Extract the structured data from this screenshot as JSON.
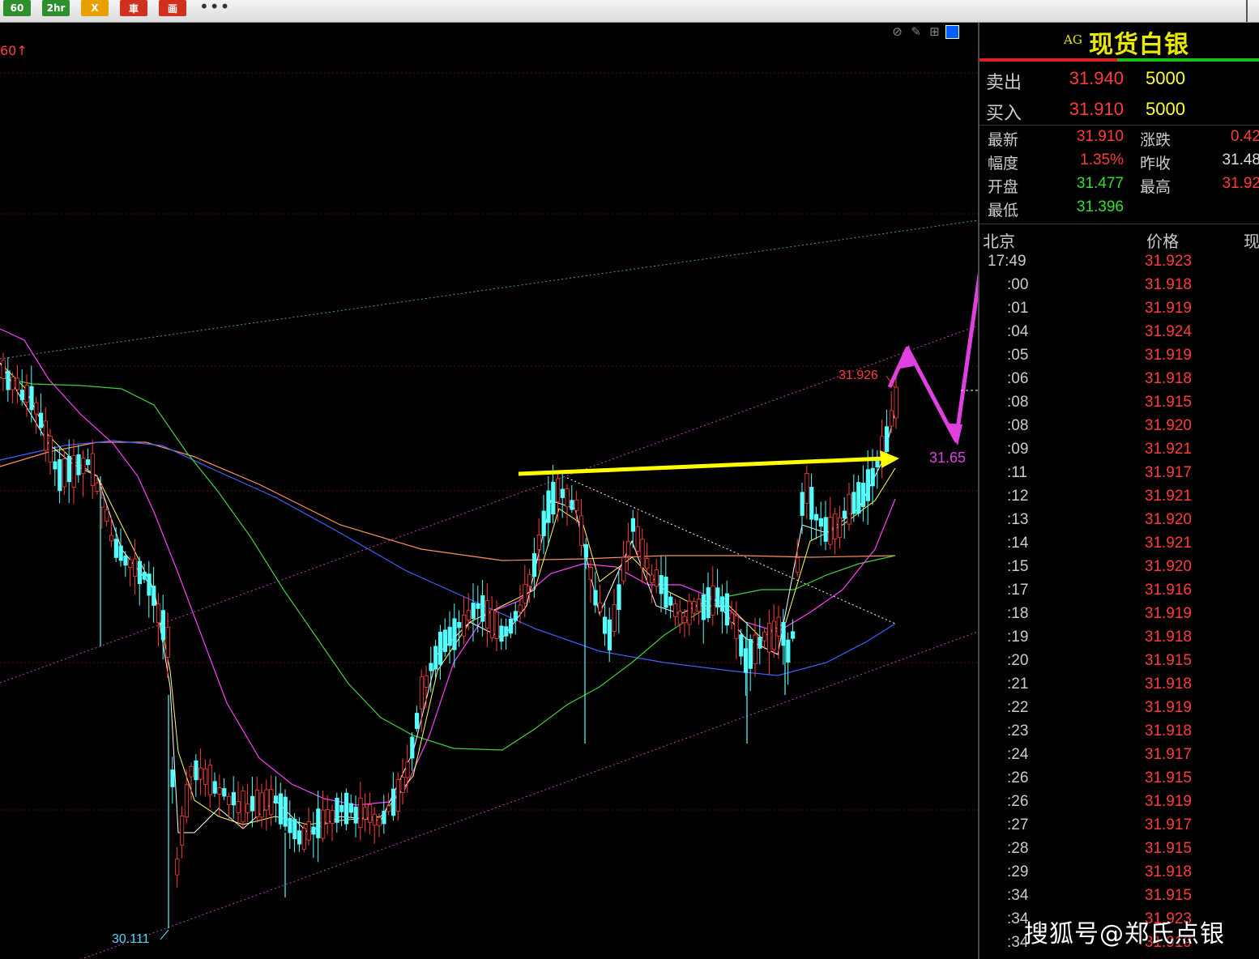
{
  "toolbar": {
    "buttons": [
      {
        "label": "60",
        "color": "#2f8f2f"
      },
      {
        "label": "2hr",
        "color": "#2f8f2f"
      },
      {
        "label": "X",
        "color": "#e8a000"
      },
      {
        "label": "車",
        "color": "#d03020"
      },
      {
        "label": "画",
        "color": "#d03020"
      }
    ],
    "more": "•••"
  },
  "chart": {
    "period_label": "60↑",
    "tools": [
      "eye-slash-icon",
      "pencil-icon",
      "grid-icon",
      "panel-toggle-icon"
    ],
    "high_label": "31.926",
    "low_label": "30.111",
    "target_label": "31.65",
    "colors": {
      "up": "#ff3c3c",
      "down": "#54ffff",
      "ma5": "#ffffff",
      "ma10": "#ffff66",
      "ma20": "#ff40ff",
      "ma60": "#40d040",
      "ma120": "#4060ff",
      "ma250": "#ff9060",
      "projection": "#e040e0",
      "resistance_arrow": "#ffff00"
    }
  },
  "panel": {
    "code": "AG",
    "name": "现货白银",
    "quote_rows": [
      {
        "label": "卖出",
        "price": "31.940",
        "volume": "5000"
      },
      {
        "label": "买入",
        "price": "31.910",
        "volume": "5000"
      }
    ],
    "stats": [
      {
        "l1": "最新",
        "v1": "31.910",
        "c1": "#ff3c3c",
        "l2": "涨跌",
        "v2": "0.42",
        "c2": "#ff3c3c"
      },
      {
        "l1": "幅度",
        "v1": "1.35%",
        "c1": "#ff3c3c",
        "l2": "昨收",
        "v2": "31.48",
        "c2": "#dddddd"
      },
      {
        "l1": "开盘",
        "v1": "31.477",
        "c1": "#30e030",
        "l2": "最高",
        "v2": "31.92",
        "c2": "#ff3c3c"
      },
      {
        "l1": "最低",
        "v1": "31.396",
        "c1": "#30e030",
        "l2": "",
        "v2": "",
        "c2": "#dddddd"
      }
    ],
    "ticks_header": {
      "time": "北京",
      "price": "价格",
      "volume": "现"
    },
    "ticks": [
      {
        "t": "17:49",
        "p": "31.923"
      },
      {
        "t": ":00",
        "p": "31.918"
      },
      {
        "t": ":01",
        "p": "31.919"
      },
      {
        "t": ":04",
        "p": "31.924"
      },
      {
        "t": ":05",
        "p": "31.919"
      },
      {
        "t": ":06",
        "p": "31.918"
      },
      {
        "t": ":08",
        "p": "31.915"
      },
      {
        "t": ":08",
        "p": "31.920"
      },
      {
        "t": ":09",
        "p": "31.921"
      },
      {
        "t": ":11",
        "p": "31.917"
      },
      {
        "t": ":12",
        "p": "31.921"
      },
      {
        "t": ":13",
        "p": "31.920"
      },
      {
        "t": ":14",
        "p": "31.921"
      },
      {
        "t": ":15",
        "p": "31.920"
      },
      {
        "t": ":17",
        "p": "31.916"
      },
      {
        "t": ":18",
        "p": "31.919"
      },
      {
        "t": ":19",
        "p": "31.918"
      },
      {
        "t": ":20",
        "p": "31.915"
      },
      {
        "t": ":21",
        "p": "31.918"
      },
      {
        "t": ":22",
        "p": "31.919"
      },
      {
        "t": ":23",
        "p": "31.918"
      },
      {
        "t": ":24",
        "p": "31.917"
      },
      {
        "t": ":26",
        "p": "31.915"
      },
      {
        "t": ":26",
        "p": "31.919"
      },
      {
        "t": ":27",
        "p": "31.917"
      },
      {
        "t": ":28",
        "p": "31.915"
      },
      {
        "t": ":29",
        "p": "31.918"
      },
      {
        "t": ":34",
        "p": "31.915"
      },
      {
        "t": ":34",
        "p": "31.923"
      },
      {
        "t": ":34",
        "p": "31.919"
      }
    ]
  },
  "watermark": "搜狐号@郑氏点银"
}
